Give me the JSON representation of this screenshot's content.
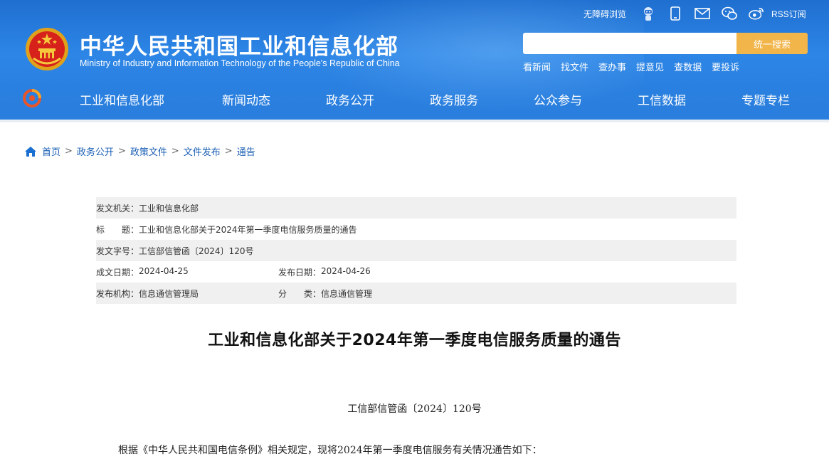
{
  "header": {
    "title": "中华人民共和国工业和信息化部",
    "subtitle": "Ministry of Industry and Information Technology of the People's Republic of China",
    "accessibility_label": "无障碍浏览",
    "rss_label": "RSS订阅",
    "icons": [
      "robot-icon",
      "mobile-icon",
      "mail-icon",
      "wechat-icon",
      "weibo-icon"
    ],
    "search": {
      "placeholder": "",
      "button_label": "统一搜索"
    },
    "quick_links": [
      "看新闻",
      "找文件",
      "查办事",
      "提意见",
      "查数据",
      "要投诉"
    ],
    "nav": [
      "工业和信息化部",
      "新闻动态",
      "政务公开",
      "政务服务",
      "公众参与",
      "工信数据",
      "专题专栏"
    ]
  },
  "breadcrumb": [
    "首页",
    "政务公开",
    "政策文件",
    "文件发布",
    "通告"
  ],
  "info": {
    "issuer_label": "发文机关：",
    "issuer": "工业和信息化部",
    "title_label": "标　　题：",
    "title": "工业和信息化部关于2024年第一季度电信服务质量的通告",
    "doc_no_label": "发文字号：",
    "doc_no": "工信部信管函〔2024〕120号",
    "written_label": "成文日期：",
    "written": "2024-04-25",
    "published_label": "发布日期：",
    "published": "2024-04-26",
    "org_label": "发布机构：",
    "org": "信息通信管理局",
    "category_label": "分　　类：",
    "category": "信息通信管理"
  },
  "article": {
    "title": "工业和信息化部关于2024年第一季度电信服务质量的通告",
    "doc_number": "工信部信管函〔2024〕120号",
    "first_paragraph": "根据《中华人民共和国电信条例》相关规定，现将2024年第一季度电信服务有关情况通告如下："
  },
  "colors": {
    "header_blue": "#2a7edd",
    "search_button": "#f2b54a",
    "link_blue": "#1a5fb4",
    "info_row_shade": "#f0f0f0"
  }
}
